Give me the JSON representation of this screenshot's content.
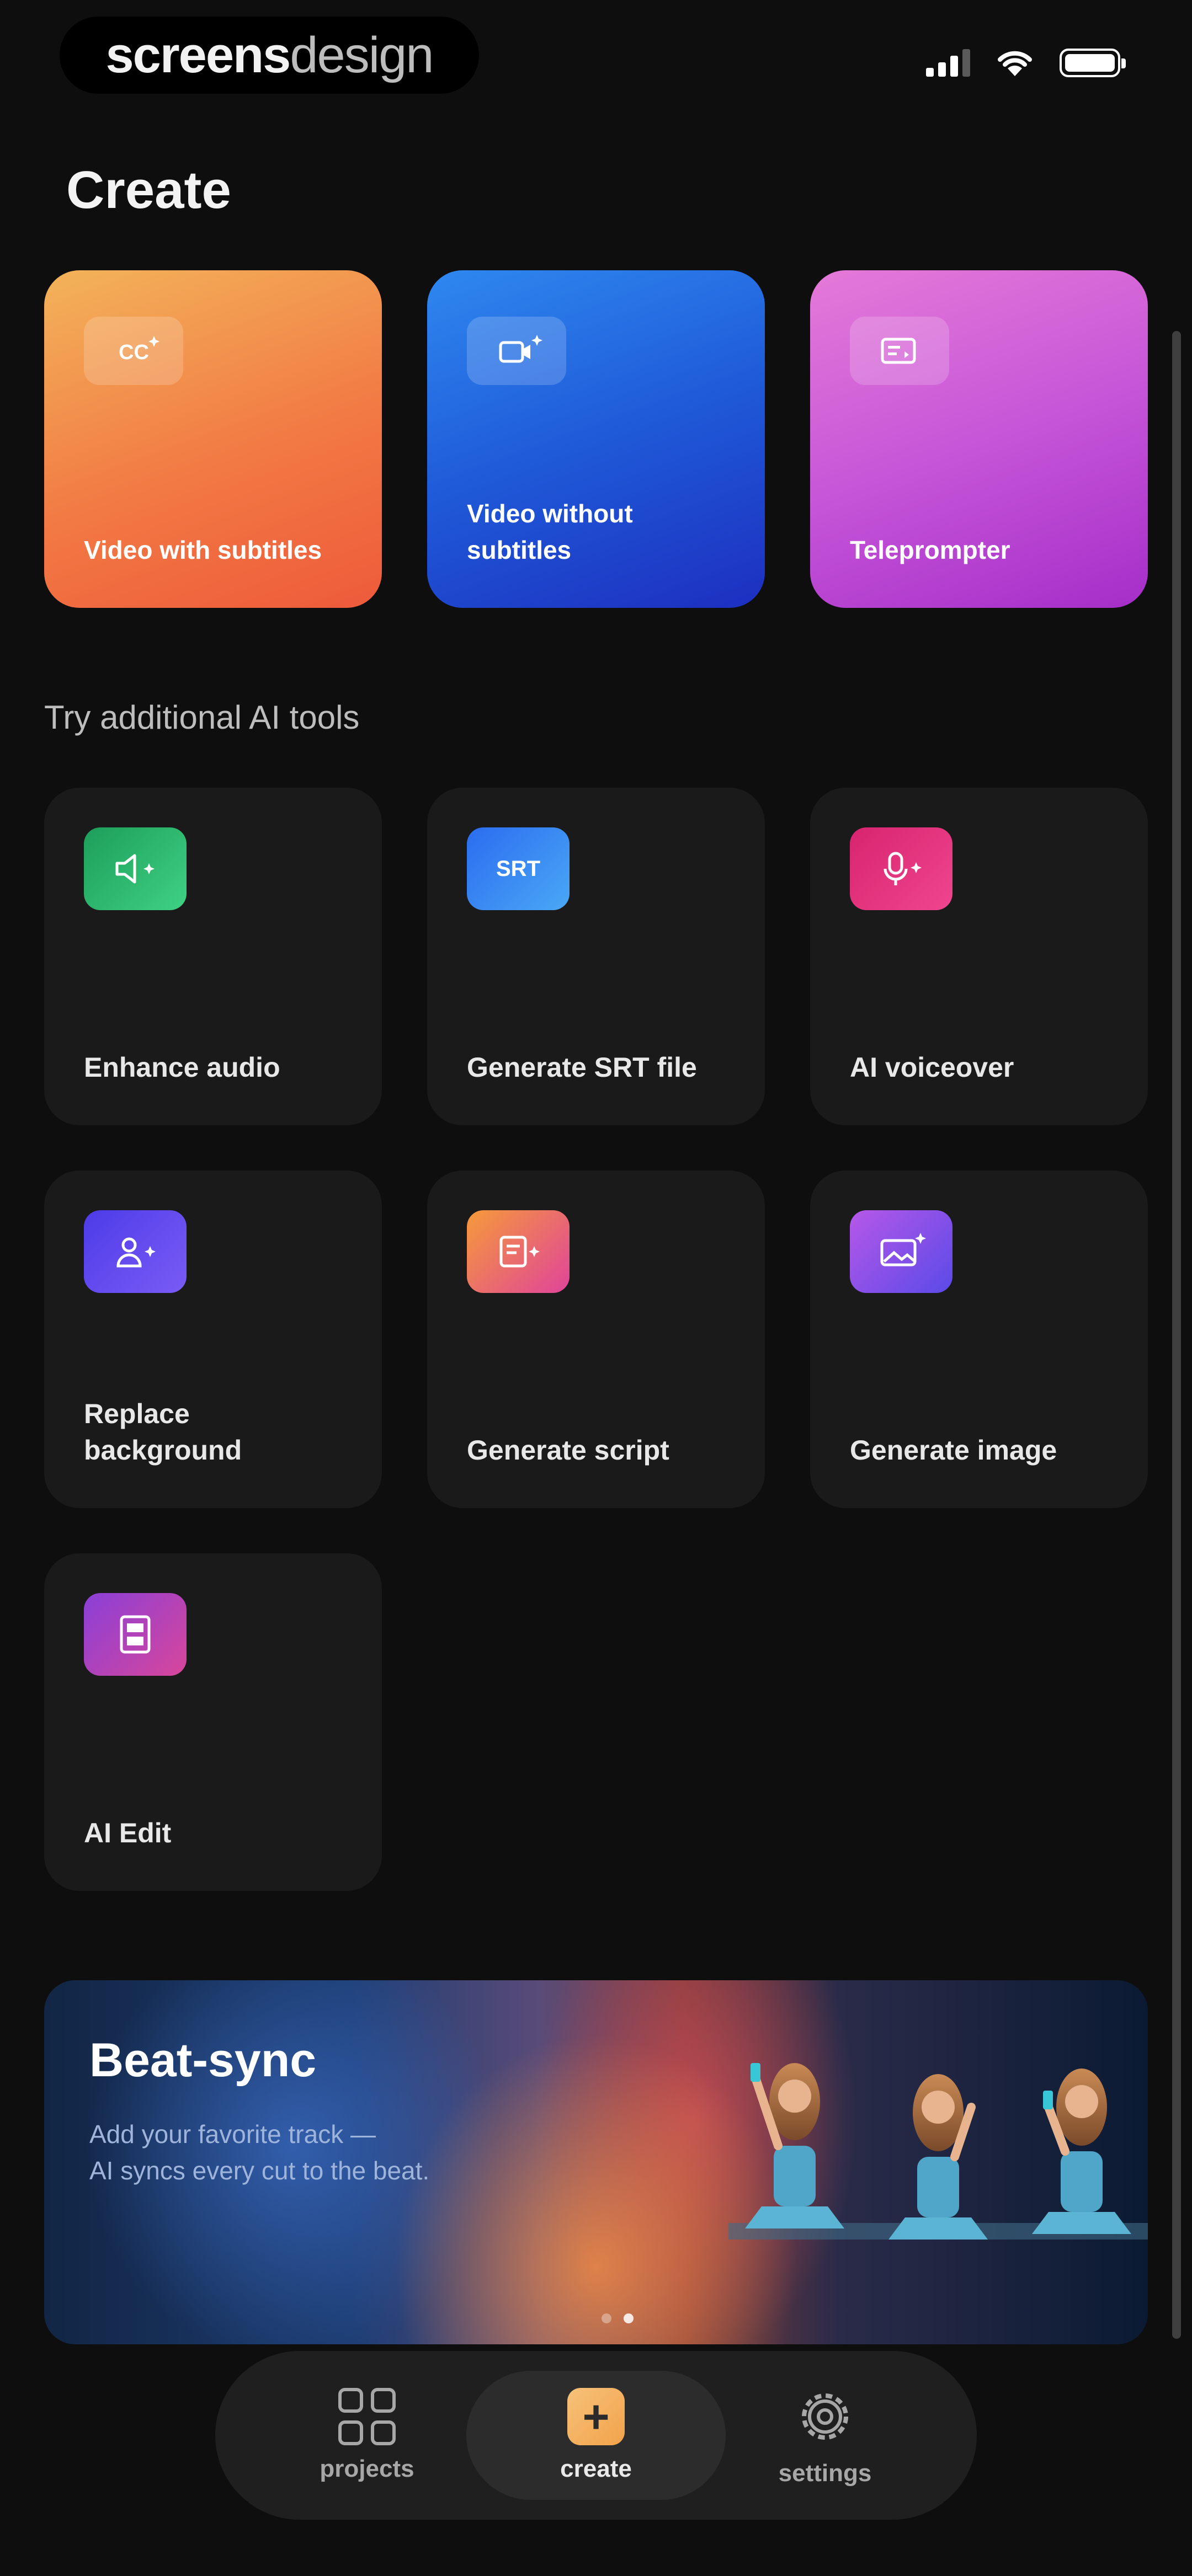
{
  "status_bar": {
    "brand_bold": "screens",
    "brand_light": "design"
  },
  "page": {
    "title": "Create"
  },
  "create_cards": [
    {
      "label": "Video with subtitles",
      "icon": "cc-icon",
      "gradient": [
        "#f3b35a",
        "#ee5a3a"
      ]
    },
    {
      "label": "Video without subtitles",
      "icon": "video-camera-icon",
      "gradient": [
        "#2f88f0",
        "#1d2fc0"
      ]
    },
    {
      "label": "Teleprompter",
      "icon": "teleprompter-icon",
      "gradient": [
        "#e57ad8",
        "#a52ec9"
      ]
    }
  ],
  "tools_section": {
    "title": "Try additional AI tools"
  },
  "tools": [
    {
      "label": "Enhance audio",
      "icon": "speaker-sparkle-icon"
    },
    {
      "label": "Generate SRT file",
      "icon": "srt-icon",
      "icon_text": "SRT"
    },
    {
      "label": "AI voiceover",
      "icon": "microphone-sparkle-icon"
    },
    {
      "label": "Replace background",
      "icon": "person-sparkle-icon"
    },
    {
      "label": "Generate script",
      "icon": "script-sparkle-icon"
    },
    {
      "label": "Generate image",
      "icon": "image-sparkle-icon"
    },
    {
      "label": "AI Edit",
      "icon": "film-edit-icon"
    }
  ],
  "banner": {
    "title": "Beat-sync",
    "subtitle_line1": "Add your favorite track —",
    "subtitle_line2": "AI syncs every cut to the beat.",
    "pagination_total": 2,
    "pagination_active": 2
  },
  "tab_bar": {
    "tabs": [
      {
        "label": "projects",
        "icon": "grid-icon",
        "active": false
      },
      {
        "label": "create",
        "icon": "plus-square-icon",
        "active": true
      },
      {
        "label": "settings",
        "icon": "gear-icon",
        "active": false
      }
    ]
  },
  "colors": {
    "background": "#0e0e0f",
    "card": "#1a1a1b",
    "create_accent": "#f2a24a"
  }
}
